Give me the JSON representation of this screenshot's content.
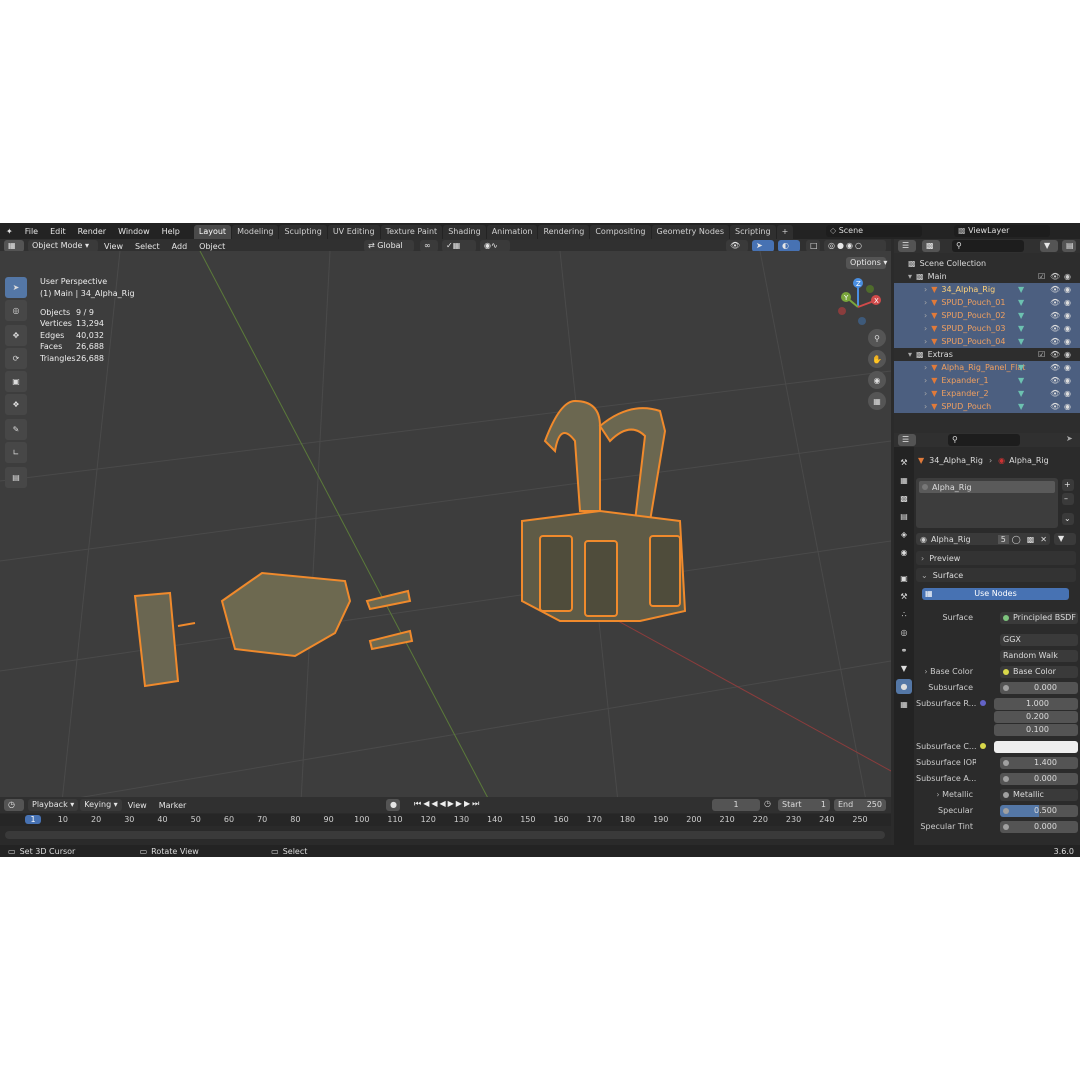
{
  "menu": {
    "file": "File",
    "edit": "Edit",
    "render": "Render",
    "window": "Window",
    "help": "Help"
  },
  "workspaces": [
    "Layout",
    "Modeling",
    "Sculpting",
    "UV Editing",
    "Texture Paint",
    "Shading",
    "Animation",
    "Rendering",
    "Compositing",
    "Geometry Nodes",
    "Scripting"
  ],
  "scene": "Scene",
  "view_layer": "ViewLayer",
  "viewport": {
    "mode": "Object Mode",
    "menus": {
      "view": "View",
      "select": "Select",
      "add": "Add",
      "object": "Object"
    },
    "transform": "Global",
    "options": "Options",
    "perspective": "User Perspective",
    "active": "(1) Main | 34_Alpha_Rig",
    "stats": [
      {
        "label": "Objects",
        "value": "9 / 9"
      },
      {
        "label": "Vertices",
        "value": "13,294"
      },
      {
        "label": "Edges",
        "value": "40,032"
      },
      {
        "label": "Faces",
        "value": "26,688"
      },
      {
        "label": "Triangles",
        "value": "26,688"
      }
    ],
    "gizmo": {
      "z": "Z",
      "y": "Y",
      "x": "X"
    }
  },
  "outliner": {
    "root": "Scene Collection",
    "collections": [
      {
        "name": "Main",
        "items": [
          "34_Alpha_Rig",
          "SPUD_Pouch_01",
          "SPUD_Pouch_02",
          "SPUD_Pouch_03",
          "SPUD_Pouch_04"
        ]
      },
      {
        "name": "Extras",
        "items": [
          "Alpha_Rig_Panel_Flat",
          "Expander_1",
          "Expander_2",
          "SPUD_Pouch"
        ]
      }
    ]
  },
  "properties": {
    "breadcrumb_object": "34_Alpha_Rig",
    "breadcrumb_material": "Alpha_Rig",
    "slot": "Alpha_Rig",
    "material_name": "Alpha_Rig",
    "users": "5",
    "preview": "Preview",
    "surface_panel": "Surface",
    "use_nodes": "Use Nodes",
    "rows": {
      "surface": {
        "label": "Surface",
        "value": "Principled BSDF"
      },
      "distribution": "GGX",
      "subsurface_method": "Random Walk",
      "base_color": {
        "label": "Base Color",
        "value": "Base Color"
      },
      "subsurface": {
        "label": "Subsurface",
        "value": "0.000"
      },
      "subsurface_radius": {
        "label": "Subsurface R...",
        "values": [
          "1.000",
          "0.200",
          "0.100"
        ]
      },
      "subsurface_color": {
        "label": "Subsurface C..."
      },
      "subsurface_ior": {
        "label": "Subsurface IOR",
        "value": "1.400"
      },
      "subsurface_aniso": {
        "label": "Subsurface A...",
        "value": "0.000"
      },
      "metallic": {
        "label": "Metallic",
        "value": "Metallic"
      },
      "specular": {
        "label": "Specular",
        "value": "0.500"
      },
      "specular_tint": {
        "label": "Specular Tint",
        "value": "0.000"
      }
    }
  },
  "timeline": {
    "menus": {
      "playback": "Playback",
      "keying": "Keying",
      "view": "View",
      "marker": "Marker"
    },
    "current_frame": "1",
    "start_label": "Start",
    "start": "1",
    "end_label": "End",
    "end": "250",
    "ticks": [
      "1",
      "10",
      "20",
      "30",
      "40",
      "50",
      "60",
      "70",
      "80",
      "90",
      "100",
      "110",
      "120",
      "130",
      "140",
      "150",
      "160",
      "170",
      "180",
      "190",
      "200",
      "210",
      "220",
      "230",
      "240",
      "250"
    ]
  },
  "status": {
    "set_cursor": "Set 3D Cursor",
    "rotate": "Rotate View",
    "select": "Select",
    "version": "3.6.0"
  },
  "colors": {
    "selection": "#f08a2c",
    "active_tab": "#5477a6",
    "outliner_sel": "#4c5f80",
    "use_nodes": "#4772b3"
  }
}
